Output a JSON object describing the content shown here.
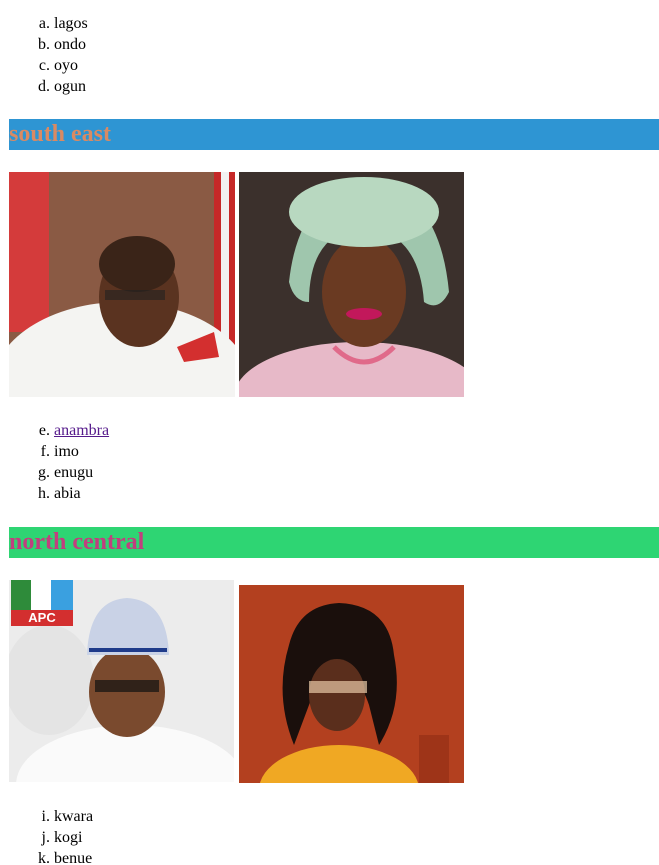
{
  "south_west": {
    "states": [
      {
        "marker": "a.",
        "name": "lagos"
      },
      {
        "marker": "b.",
        "name": "ondo"
      },
      {
        "marker": "c.",
        "name": "oyo"
      },
      {
        "marker": "d.",
        "name": "ogun"
      }
    ]
  },
  "south_east": {
    "title": "south east",
    "states": [
      {
        "marker": "e.",
        "name": "anambra"
      },
      {
        "marker": "f.",
        "name": "imo"
      },
      {
        "marker": "g.",
        "name": "enugu"
      },
      {
        "marker": "h.",
        "name": "abia"
      }
    ]
  },
  "north_central": {
    "title": "north central",
    "states": [
      {
        "marker": "i.",
        "name": "kwara"
      },
      {
        "marker": "j.",
        "name": "kogi"
      },
      {
        "marker": "k.",
        "name": "benue"
      }
    ],
    "logo_text": "APC"
  },
  "colors": {
    "south_east_header_bg": "#2e95d3",
    "south_east_header_text": "#d98a63",
    "north_central_header_bg": "#2ed573",
    "north_central_header_text": "#c0407e",
    "link_visited": "#551a8b"
  }
}
